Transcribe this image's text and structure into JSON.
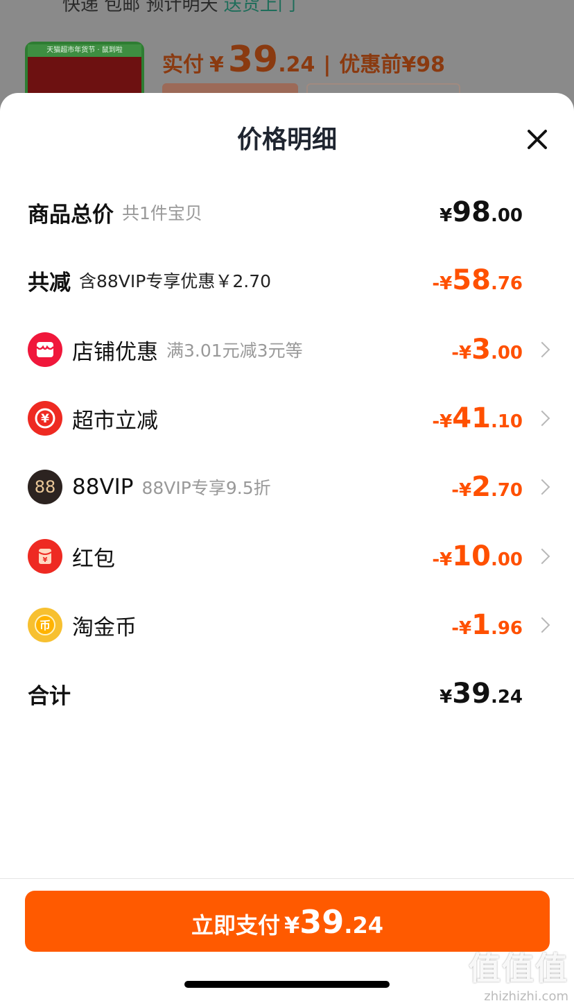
{
  "background": {
    "top_text": "快递 包邮 预计明天送货上门",
    "top_link": "送货上门",
    "thumb_caption": "天猫超市年货节 · 鼠到啦",
    "paid_label": "实付",
    "paid_currency": "¥",
    "paid_int": "39",
    "paid_dec": ".24",
    "separator": "|",
    "pre_discount": "优惠前¥98"
  },
  "sheet": {
    "title": "价格明细",
    "close_icon": "close-icon"
  },
  "rows": {
    "total": {
      "label": "商品总价",
      "sub": "共1件宝贝",
      "cur": "¥",
      "int": "98",
      "dec": ".00"
    },
    "reduce": {
      "label": "共减",
      "sub": "含88VIP专享优惠￥2.70",
      "cur": "-¥",
      "int": "58",
      "dec": ".76"
    },
    "shop": {
      "icon": "shop-icon",
      "label": "店铺优惠",
      "sub": "满3.01元减3元等",
      "cur": "-¥",
      "int": "3",
      "dec": ".00"
    },
    "market": {
      "icon": "yen-coin-icon",
      "label": "超市立减",
      "sub": "",
      "cur": "-¥",
      "int": "41",
      "dec": ".10"
    },
    "vip": {
      "icon_text": "88",
      "label": "88VIP",
      "sub": "88VIP专享9.5折",
      "cur": "-¥",
      "int": "2",
      "dec": ".70"
    },
    "hongbao": {
      "icon": "red-envelope-icon",
      "label": "红包",
      "sub": "",
      "cur": "-¥",
      "int": "10",
      "dec": ".00"
    },
    "coin": {
      "icon": "gold-coin-icon",
      "label": "淘金币",
      "sub": "",
      "cur": "-¥",
      "int": "1",
      "dec": ".96"
    },
    "sum": {
      "label": "合计",
      "cur": "¥",
      "int": "39",
      "dec": ".24"
    }
  },
  "pay_button": {
    "label": "立即支付",
    "cur": "¥",
    "int": "39",
    "dec": ".24"
  },
  "watermark": {
    "big": "值值值",
    "small": "zhizhizhi.com"
  },
  "colors": {
    "accent": "#ff5000",
    "button": "#ff5a00"
  }
}
